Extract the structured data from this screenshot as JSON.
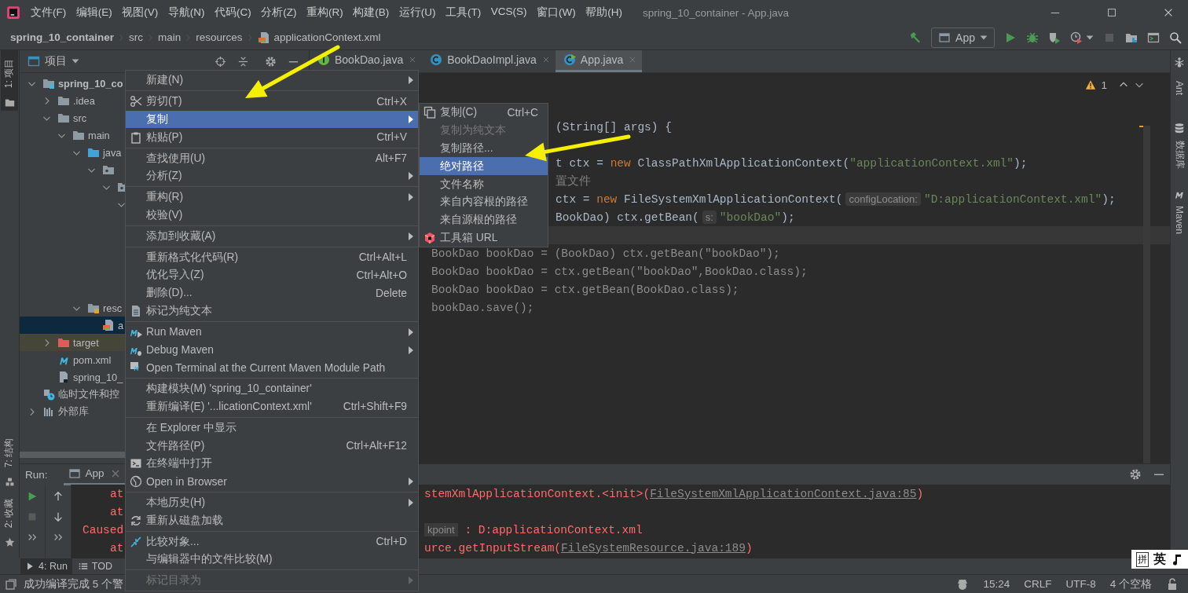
{
  "title_bar": {
    "menus": [
      "文件(F)",
      "编辑(E)",
      "视图(V)",
      "导航(N)",
      "代码(C)",
      "分析(Z)",
      "重构(R)",
      "构建(B)",
      "运行(U)",
      "工具(T)",
      "VCS(S)",
      "窗口(W)",
      "帮助(H)"
    ],
    "title": "spring_10_container - App.java"
  },
  "nav_bar": {
    "breadcrumbs": [
      {
        "label": "spring_10_container",
        "kind": "module"
      },
      {
        "label": "src",
        "kind": "folder"
      },
      {
        "label": "main",
        "kind": "folder"
      },
      {
        "label": "resources",
        "kind": "folder"
      },
      {
        "label": "applicationContext.xml",
        "kind": "xml-file"
      }
    ],
    "run_config": "App"
  },
  "left_stripe": [
    {
      "label": "1: 项目",
      "kind": "project",
      "selected": true
    },
    {
      "label": "7: 结构",
      "kind": "structure",
      "selected": false
    },
    {
      "label": "2: 收藏",
      "kind": "favorites",
      "selected": false
    }
  ],
  "project": {
    "title": "项目",
    "tree": [
      {
        "label": "spring_10_co",
        "kind": "module",
        "expanded": true,
        "selected": false,
        "children": [
          {
            "label": ".idea",
            "kind": "folder",
            "expanded": false,
            "selected": false
          },
          {
            "label": "src",
            "kind": "folder",
            "expanded": true,
            "selected": false,
            "children": [
              {
                "label": "main",
                "kind": "folder",
                "expanded": true,
                "selected": false,
                "children": [
                  {
                    "label": "java",
                    "kind": "source-folder",
                    "expanded": true,
                    "selected": false,
                    "children": [
                      {
                        "kind": "package",
                        "expanded": true,
                        "selected": false,
                        "children": [
                          {
                            "kind": "package",
                            "expanded": true,
                            "selected": false,
                            "children": [
                              {
                                "expanded": true,
                                "selected": false
                              }
                            ]
                          }
                        ]
                      }
                    ]
                  },
                  {
                    "label": "resc",
                    "kind": "resource-folder",
                    "expanded": true,
                    "selected": false,
                    "children": [
                      {
                        "label": "a",
                        "kind": "xml-file",
                        "selected": true
                      }
                    ]
                  }
                ]
              }
            ]
          },
          {
            "label": "target",
            "kind": "excluded-folder",
            "expanded": false,
            "selected": false
          },
          {
            "label": "pom.xml",
            "kind": "maven-file",
            "selected": false
          },
          {
            "label": "spring_10_",
            "kind": "iml-file",
            "selected": false
          }
        ]
      },
      {
        "label": "临时文件和控",
        "kind": "scratch",
        "selected": false
      },
      {
        "label": "外部库",
        "kind": "library",
        "expanded": false,
        "selected": false
      }
    ]
  },
  "editor": {
    "tabs": [
      {
        "label": "BookDao.java",
        "kind": "interface",
        "selected": false
      },
      {
        "label": "BookDaoImpl.java",
        "kind": "class",
        "selected": false
      },
      {
        "label": "App.java",
        "kind": "app-class",
        "selected": true
      }
    ],
    "problems": "1",
    "lines": [
      {
        "kind": "clipped",
        "current": false,
        "segments": [
          {
            "kind": "plain",
            "text": "(String[] args) {"
          }
        ]
      },
      {
        "kind": "clipped",
        "current": false
      },
      {
        "kind": "clipped",
        "current": false,
        "segments": [
          {
            "kind": "plain",
            "text": "t ctx = "
          },
          {
            "kind": "keyword",
            "text": "new"
          },
          {
            "kind": "plain",
            "text": " ClassPathXmlApplicationContext("
          },
          {
            "kind": "string",
            "text": "\"applicationContext.xml\""
          },
          {
            "kind": "plain",
            "text": ");"
          }
        ]
      },
      {
        "kind": "clipped",
        "current": false,
        "segments": [
          {
            "kind": "comment",
            "text": "置文件"
          }
        ]
      },
      {
        "kind": "clipped",
        "current": false,
        "segments": [
          {
            "kind": "plain",
            "text": "ctx = "
          },
          {
            "kind": "keyword",
            "text": "new"
          },
          {
            "kind": "plain",
            "text": " FileSystemXmlApplicationContext("
          },
          {
            "kind": "hint",
            "text": "configLocation:"
          },
          {
            "kind": "string",
            "text": "\"D:applicationContext.xml\""
          },
          {
            "kind": "plain",
            "text": ");"
          }
        ]
      },
      {
        "kind": "clipped",
        "current": false,
        "segments": [
          {
            "kind": "plain",
            "text": "BookDao) ctx.getBean("
          },
          {
            "kind": "hint",
            "text": "s:"
          },
          {
            "kind": "string",
            "text": "\"bookDao\""
          },
          {
            "kind": "plain",
            "text": ");"
          }
        ]
      },
      {
        "kind": "full",
        "current": true
      },
      {
        "kind": "full",
        "current": false,
        "segments": [
          {
            "kind": "dim",
            "text": "BookDao bookDao = (BookDao) ctx.getBean(\"bookDao\");"
          }
        ]
      },
      {
        "kind": "full",
        "current": false,
        "segments": [
          {
            "kind": "dim",
            "text": "BookDao bookDao = ctx.getBean(\"bookDao\",BookDao.class);"
          }
        ]
      },
      {
        "kind": "full",
        "current": false,
        "segments": [
          {
            "kind": "dim",
            "text": "BookDao bookDao = ctx.getBean(BookDao.class);"
          }
        ]
      },
      {
        "kind": "full",
        "current": false,
        "segments": [
          {
            "kind": "dim",
            "text": "bookDao.save();"
          }
        ]
      }
    ]
  },
  "right_stripe": [
    {
      "label": "Ant",
      "kind": "ant"
    },
    {
      "label": "数据库",
      "kind": "database"
    },
    {
      "label": "Maven",
      "kind": "maven"
    }
  ],
  "run": {
    "label": "Run:",
    "tab": "App",
    "console": [
      {
        "left": "at",
        "indented": true,
        "segments": [
          {
            "kind": "error",
            "text": "stemXmlApplicationContext.<init>("
          },
          {
            "kind": "link",
            "text": "FileSystemXmlApplicationContext.java:85"
          },
          {
            "kind": "error",
            "text": ")"
          }
        ]
      },
      {
        "left": "at",
        "indented": true
      },
      {
        "left": "Caused",
        "indented": false,
        "segments": [
          {
            "kind": "hint",
            "text": "kpoint"
          },
          {
            "kind": "error",
            "text": " : D:applicationContext.xml"
          }
        ]
      },
      {
        "left": "at",
        "indented": true,
        "segments": [
          {
            "kind": "error",
            "text": "urce.getInputStream("
          },
          {
            "kind": "link",
            "text": "FileSystemResource.java:189"
          },
          {
            "kind": "error",
            "text": ")"
          }
        ]
      }
    ]
  },
  "tool_tabs": [
    {
      "label": "4: Run",
      "kind": "run",
      "selected": true
    },
    {
      "label": "TOD",
      "kind": "todo",
      "selected": false
    }
  ],
  "status_bar": {
    "message": "成功编译完成 5 个警",
    "position": "15:24",
    "line_separator": "CRLF",
    "encoding": "UTF-8",
    "indent": "4 个空格"
  },
  "context_menu": {
    "groups": [
      [
        {
          "label": "新建(N)",
          "kind": "plain",
          "submenu": true,
          "selected": false,
          "disabled": false
        }
      ],
      [
        {
          "label": "剪切(T)",
          "shortcut": "Ctrl+X",
          "kind": "cut",
          "submenu": false,
          "selected": false,
          "disabled": false
        },
        {
          "label": "复制",
          "kind": "plain",
          "submenu": true,
          "selected": true,
          "disabled": false
        },
        {
          "label": "粘贴(P)",
          "shortcut": "Ctrl+V",
          "kind": "paste",
          "submenu": false,
          "selected": false,
          "disabled": false
        }
      ],
      [
        {
          "label": "查找使用(U)",
          "shortcut": "Alt+F7",
          "kind": "plain",
          "submenu": false,
          "selected": false,
          "disabled": false
        },
        {
          "label": "分析(Z)",
          "kind": "plain",
          "submenu": true,
          "selected": false,
          "disabled": false
        }
      ],
      [
        {
          "label": "重构(R)",
          "kind": "plain",
          "submenu": true,
          "selected": false,
          "disabled": false
        },
        {
          "label": "校验(V)",
          "kind": "plain",
          "submenu": false,
          "selected": false,
          "disabled": false
        }
      ],
      [
        {
          "label": "添加到收藏(A)",
          "kind": "plain",
          "submenu": true,
          "selected": false,
          "disabled": false
        }
      ],
      [
        {
          "label": "重新格式化代码(R)",
          "shortcut": "Ctrl+Alt+L",
          "kind": "plain",
          "submenu": false,
          "selected": false,
          "disabled": false
        },
        {
          "label": "优化导入(Z)",
          "shortcut": "Ctrl+Alt+O",
          "kind": "plain",
          "submenu": false,
          "selected": false,
          "disabled": false
        },
        {
          "label": "删除(D)...",
          "shortcut": "Delete",
          "kind": "plain",
          "submenu": false,
          "selected": false,
          "disabled": false
        },
        {
          "label": "标记为纯文本",
          "kind": "mark-text",
          "submenu": false,
          "selected": false,
          "disabled": false
        }
      ],
      [
        {
          "label": "Run Maven",
          "kind": "run-maven",
          "submenu": true,
          "selected": false,
          "disabled": false
        },
        {
          "label": "Debug Maven",
          "kind": "debug-maven",
          "submenu": true,
          "selected": false,
          "disabled": false
        },
        {
          "label": "Open Terminal at the Current Maven Module Path",
          "kind": "terminal-maven",
          "submenu": false,
          "selected": false,
          "disabled": false
        }
      ],
      [
        {
          "label": "构建模块(M) 'spring_10_container'",
          "kind": "plain",
          "submenu": false,
          "selected": false,
          "disabled": false
        },
        {
          "label": "重新编译(E) '...licationContext.xml'",
          "shortcut": "Ctrl+Shift+F9",
          "kind": "plain",
          "submenu": false,
          "selected": false,
          "disabled": false
        }
      ],
      [
        {
          "label": "在 Explorer 中显示",
          "kind": "plain",
          "submenu": false,
          "selected": false,
          "disabled": false
        },
        {
          "label": "文件路径(P)",
          "shortcut": "Ctrl+Alt+F12",
          "kind": "plain",
          "submenu": false,
          "selected": false,
          "disabled": false
        },
        {
          "label": "在终端中打开",
          "kind": "terminal",
          "submenu": false,
          "selected": false,
          "disabled": false
        },
        {
          "label": "Open in Browser",
          "kind": "globe",
          "submenu": true,
          "selected": false,
          "disabled": false
        }
      ],
      [
        {
          "label": "本地历史(H)",
          "kind": "plain",
          "submenu": true,
          "selected": false,
          "disabled": false
        },
        {
          "label": "重新从磁盘加载",
          "kind": "reload",
          "submenu": false,
          "selected": false,
          "disabled": false
        }
      ],
      [
        {
          "label": "比较对象...",
          "shortcut": "Ctrl+D",
          "kind": "compare",
          "submenu": false,
          "selected": false,
          "disabled": false
        },
        {
          "label": "与编辑器中的文件比较(M)",
          "kind": "plain",
          "submenu": false,
          "selected": false,
          "disabled": false
        }
      ],
      [
        {
          "label": "标记目录为",
          "kind": "plain",
          "submenu": true,
          "selected": false,
          "disabled": true
        }
      ]
    ]
  },
  "submenu": {
    "items": [
      {
        "label": "复制(C)",
        "shortcut": "Ctrl+C",
        "kind": "copy",
        "selected": false,
        "disabled": false
      },
      {
        "label": "复制为纯文本",
        "kind": "plain",
        "selected": false,
        "disabled": true
      },
      {
        "label": "复制路径...",
        "kind": "plain",
        "selected": false,
        "disabled": false
      },
      {
        "label": "绝对路径",
        "kind": "plain",
        "selected": true,
        "disabled": false
      },
      {
        "label": "文件名称",
        "kind": "plain",
        "selected": false,
        "disabled": false
      },
      {
        "label": "来自内容根的路径",
        "kind": "plain",
        "selected": false,
        "disabled": false
      },
      {
        "label": "来自源根的路径",
        "kind": "plain",
        "selected": false,
        "disabled": false
      },
      {
        "label": "工具箱 URL",
        "kind": "toolbox",
        "selected": false,
        "disabled": false
      }
    ]
  },
  "annotations": [
    {
      "kind": "arrow"
    },
    {
      "kind": "arrow"
    }
  ],
  "ime_bar": {
    "mode": "拼",
    "language": "英"
  }
}
